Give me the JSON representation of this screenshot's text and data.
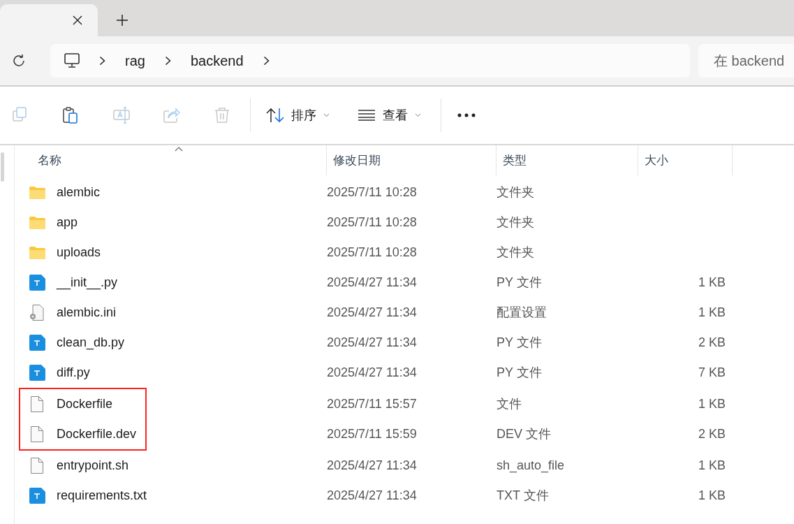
{
  "tabs": [
    {
      "selected": true
    }
  ],
  "address_bar": {
    "path": [
      "rag",
      "backend"
    ]
  },
  "search": {
    "placeholder": "在 backend"
  },
  "toolbar": {
    "actions": [
      {
        "kind": "copy",
        "disabled": true
      },
      {
        "kind": "paste",
        "disabled": false
      },
      {
        "kind": "rename",
        "disabled": true
      },
      {
        "kind": "share",
        "disabled": true
      },
      {
        "kind": "delete",
        "disabled": true
      }
    ],
    "sort_button": "排序",
    "view_button": "查看"
  },
  "table": {
    "columns": [
      "名称",
      "修改日期",
      "类型",
      "大小"
    ],
    "rows": [
      {
        "kind": "folder",
        "name": "alembic",
        "modified": "2025/7/11 10:28",
        "type": "文件夹",
        "highlighted": false
      },
      {
        "kind": "folder",
        "name": "app",
        "modified": "2025/7/11 10:28",
        "type": "文件夹",
        "highlighted": false
      },
      {
        "kind": "folder",
        "name": "uploads",
        "modified": "2025/7/11 10:28",
        "type": "文件夹",
        "highlighted": false
      },
      {
        "kind": "text",
        "name": "__init__.py",
        "modified": "2025/4/27 11:34",
        "type": "PY 文件",
        "size": "1 KB",
        "highlighted": false
      },
      {
        "kind": "config",
        "name": "alembic.ini",
        "modified": "2025/4/27 11:34",
        "type": "配置设置",
        "size": "1 KB",
        "highlighted": false
      },
      {
        "kind": "text",
        "name": "clean_db.py",
        "modified": "2025/4/27 11:34",
        "type": "PY 文件",
        "size": "2 KB",
        "highlighted": false
      },
      {
        "kind": "text",
        "name": "diff.py",
        "modified": "2025/4/27 11:34",
        "type": "PY 文件",
        "size": "7 KB",
        "highlighted": false
      },
      {
        "kind": "file",
        "name": "Dockerfile",
        "modified": "2025/7/11 15:57",
        "type": "文件",
        "size": "1 KB",
        "highlighted": true
      },
      {
        "kind": "file",
        "name": "Dockerfile.dev",
        "modified": "2025/7/11 15:59",
        "type": "DEV 文件",
        "size": "2 KB",
        "highlighted": true
      },
      {
        "kind": "file",
        "name": "entrypoint.sh",
        "modified": "2025/4/27 11:34",
        "type": "sh_auto_file",
        "size": "1 KB",
        "highlighted": false
      },
      {
        "kind": "text",
        "name": "requirements.txt",
        "modified": "2025/4/27 11:34",
        "type": "TXT 文件",
        "size": "1 KB",
        "highlighted": false
      }
    ]
  }
}
